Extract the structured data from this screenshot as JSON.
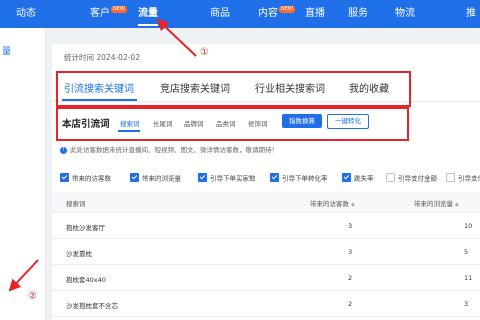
{
  "topnav": {
    "items": [
      {
        "label": "动态"
      },
      {
        "label": "客户",
        "badge": "NEW"
      },
      {
        "label": "流量",
        "active": true
      },
      {
        "label": "商品"
      },
      {
        "label": "内容",
        "badge": "NEW"
      },
      {
        "label": "直播"
      },
      {
        "label": "服务"
      },
      {
        "label": "物流"
      },
      {
        "label": "推"
      }
    ]
  },
  "leftrail": {
    "label": "量"
  },
  "panel": {
    "stat_time": "统计时间 2024-02-02",
    "tabs": [
      {
        "label": "引流搜索关键词",
        "active": true
      },
      {
        "label": "竞店搜索关键词"
      },
      {
        "label": "行业相关搜索词"
      },
      {
        "label": "我的收藏"
      }
    ],
    "sub": {
      "title": "本店引流词",
      "tabs": [
        {
          "label": "搜索词",
          "active": true
        },
        {
          "label": "长尾词"
        },
        {
          "label": "品牌词"
        },
        {
          "label": "品类词"
        },
        {
          "label": "修饰词"
        }
      ],
      "convert_button": "指数换算",
      "one_click_button": "一键转化"
    },
    "notice": "此处访客数据未统计直播间、短视频、图文、微详情访客数，敬请期待！",
    "filters": [
      {
        "label": "带来的访客数",
        "checked": true
      },
      {
        "label": "带来的浏览量",
        "checked": true
      },
      {
        "label": "引导下单买家数",
        "checked": true
      },
      {
        "label": "引导下单转化率",
        "checked": true
      },
      {
        "label": "跳失率",
        "checked": true
      },
      {
        "label": "引导支付金额",
        "checked": false
      },
      {
        "label": "引导支付",
        "checked": false
      }
    ],
    "table": {
      "headers": [
        "搜索词",
        "带来的访客数",
        "带来的浏览量"
      ],
      "rows": [
        [
          "抱枕沙发客厅",
          "3",
          "10"
        ],
        [
          "沙发靠枕",
          "3",
          "5"
        ],
        [
          "抱枕套40x40",
          "2",
          "11"
        ],
        [
          "沙发抱枕套不含芯",
          "2",
          "3"
        ]
      ]
    }
  },
  "annotations": {
    "label_1": "①",
    "label_2": "②"
  },
  "colors": {
    "accent": "#1f6fe8",
    "annotation": "#e8232a"
  }
}
